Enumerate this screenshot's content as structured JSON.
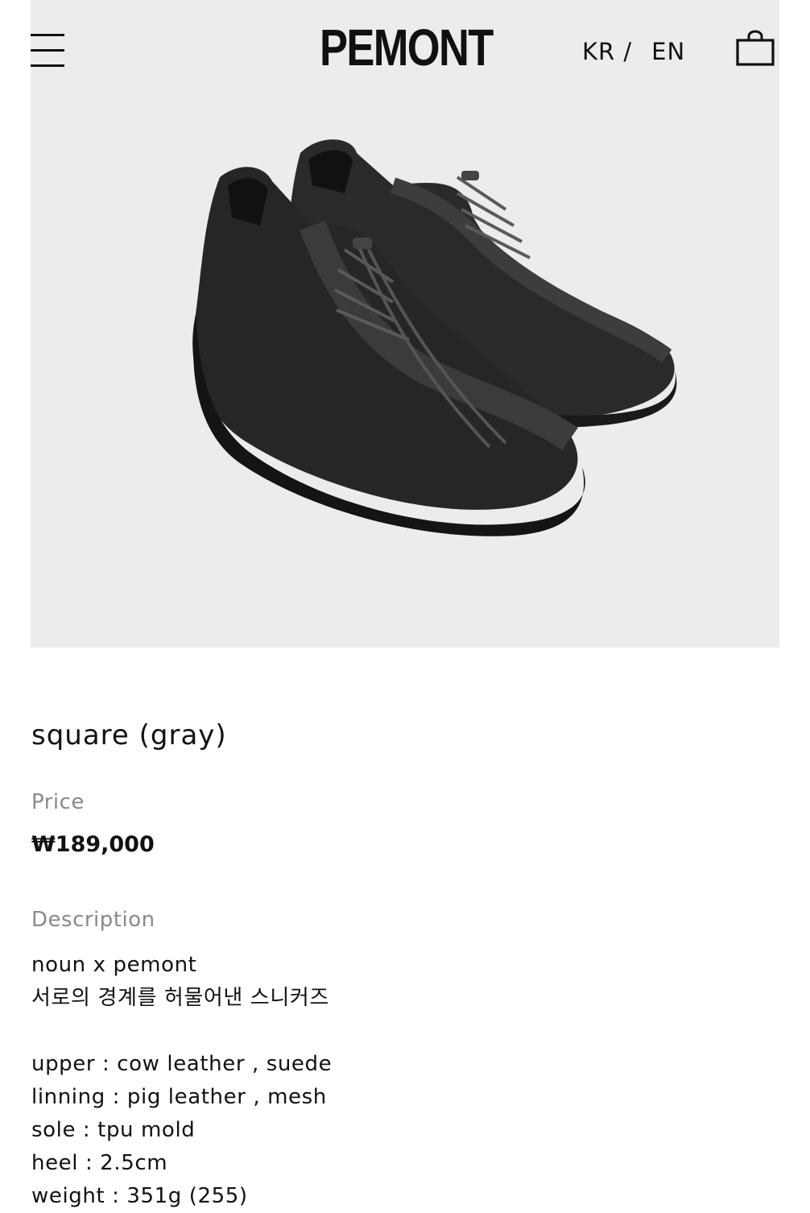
{
  "header": {
    "logo": "PEMONT",
    "lang_kr": "KR /",
    "lang_en": "EN",
    "menu_icon": "hamburger-menu-icon",
    "cart_icon": "shopping-bag-icon"
  },
  "hero": {
    "image_icon": "sneaker-pair-image",
    "background": "#ececec"
  },
  "product": {
    "title": "square (gray)",
    "price_label": "Price",
    "price": "₩189,000",
    "description_label": "Description",
    "description_lines": [
      "noun x pemont",
      "서로의 경계를 허물어낸 스니커즈",
      "",
      "upper : cow leather , suede",
      "linning : pig leather , mesh",
      "sole : tpu mold",
      "heel : 2.5cm",
      "weight : 351g (255)"
    ]
  }
}
